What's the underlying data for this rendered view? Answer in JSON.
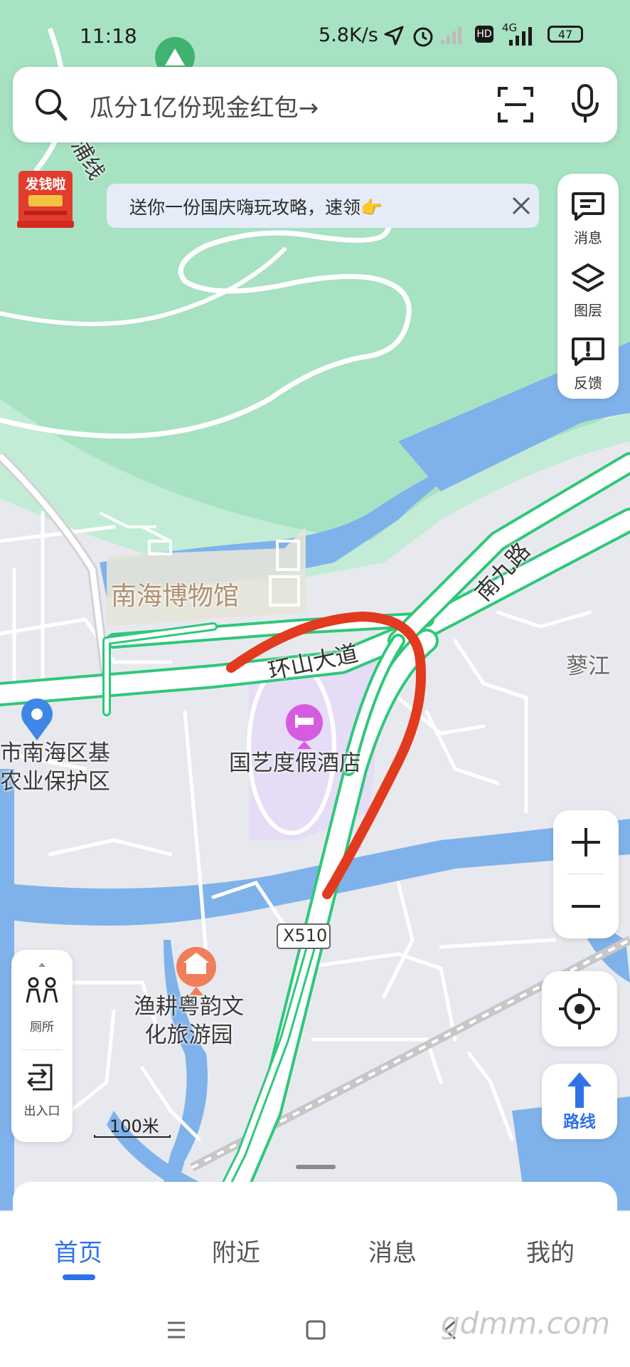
{
  "status_bar": {
    "time": "11:18",
    "net_rate": "5.8K/s",
    "battery": "47",
    "hd_label": "HD",
    "network_label": "4G"
  },
  "search": {
    "placeholder": "瓜分1亿份现金红包→"
  },
  "promo": {
    "label": "发钱啦"
  },
  "notice": {
    "text": "送你一份国庆嗨玩攻略，速领👉"
  },
  "right_tools": [
    {
      "icon": "message-icon",
      "label": "消息"
    },
    {
      "icon": "layers-icon",
      "label": "图层"
    },
    {
      "icon": "feedback-icon",
      "label": "反馈"
    }
  ],
  "map_labels": {
    "museum": "南海博物馆",
    "road_main": "环山大道",
    "road_south": "南九路",
    "area_east": "蓼江",
    "hotel": "国艺度假酒店",
    "reserve_line1": "市南海区基",
    "reserve_line2": "农业保护区",
    "park_line1": "渔耕粤韵文",
    "park_line2": "化旅游园",
    "road_route": "X510",
    "road_top_fragment": "浦线"
  },
  "left_tools": [
    {
      "icon": "toilet-icon",
      "label": "厕所"
    },
    {
      "icon": "entrance-exit-icon",
      "label": "出入口"
    }
  ],
  "route_button": {
    "label": "路线"
  },
  "scale": {
    "label": "100米"
  },
  "tabs": [
    {
      "label": "首页",
      "active": true
    },
    {
      "label": "附近",
      "active": false
    },
    {
      "label": "消息",
      "active": false
    },
    {
      "label": "我的",
      "active": false
    }
  ],
  "watermark": "gdmm.com",
  "colors": {
    "accent": "#2f72e8",
    "park_green": "#a8e3c4",
    "water_blue": "#7fb2ea",
    "road_green": "#2ec87a",
    "annotation_red": "#e23a1f"
  }
}
